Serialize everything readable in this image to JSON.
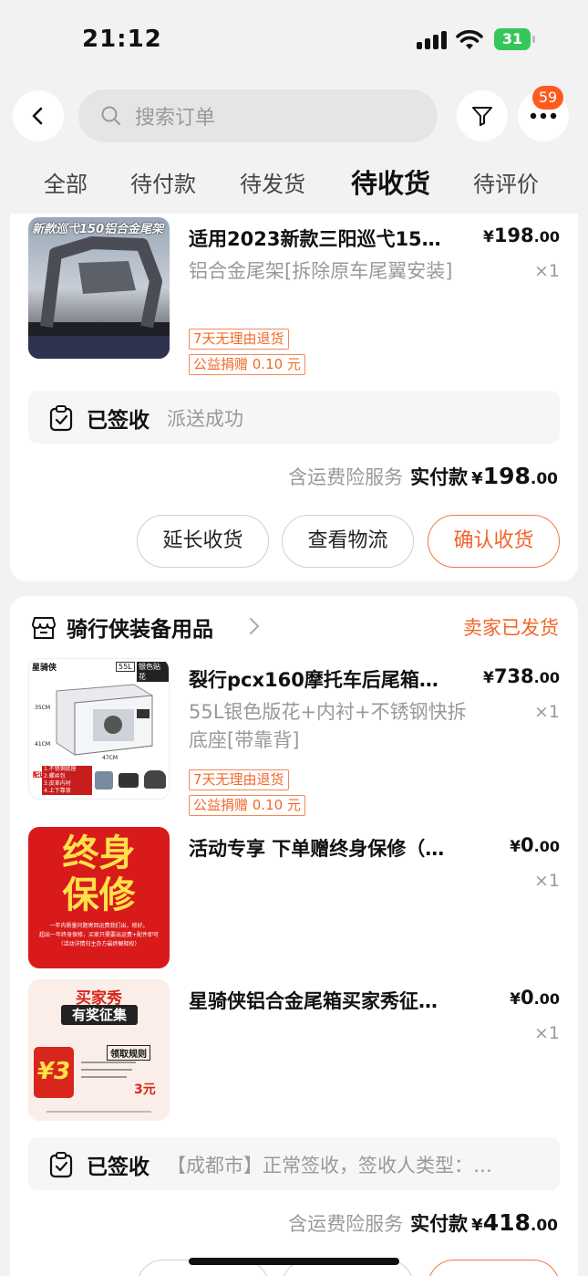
{
  "status_bar": {
    "time": "21:12",
    "battery": "31"
  },
  "header": {
    "search_placeholder": "搜索订单",
    "badge_count": "59",
    "tabs": [
      {
        "label": "全部"
      },
      {
        "label": "待付款"
      },
      {
        "label": "待发货"
      },
      {
        "label": "待收货",
        "active": true
      },
      {
        "label": "待评价"
      }
    ]
  },
  "orders": [
    {
      "items": [
        {
          "thumb_text": "新款巡弋150铝合金尾架",
          "title": "适用2023新款三阳巡弋15…",
          "price": {
            "currency": "¥",
            "int": "198",
            "dec": ".00"
          },
          "spec": "铝合金尾架[拆除原车尾翼安装]",
          "qty": "×1",
          "tags": [
            "7天无理由退货",
            "公益捐赠 0.10 元"
          ]
        }
      ],
      "status": {
        "title": "已签收",
        "detail": "派送成功"
      },
      "total": {
        "service": "含运费险服务",
        "label": "实付款",
        "currency": "¥",
        "int": "198",
        "dec": ".00"
      },
      "buttons": [
        "延长收货",
        "查看物流",
        "确认收货"
      ]
    },
    {
      "shop_name": "骑行侠装备用品",
      "shop_state": "卖家已发货",
      "items": [
        {
          "thumb_text": [
            "星骑侠",
            "55L",
            "银色贴花",
            "35CM",
            "41CM",
            "47CM",
            "1.不锈钢底座",
            "2.螺丝包",
            "3.皮革内衬",
            "4.上下靠背",
            "配送"
          ],
          "title": "裂行pcx160摩托车后尾箱…",
          "price": {
            "currency": "¥",
            "int": "738",
            "dec": ".00"
          },
          "spec": "55L银色版花+内衬+不锈钢快拆底座[带靠背]",
          "qty": "×1",
          "tags": [
            "7天无理由退货",
            "公益捐赠 0.10 元"
          ]
        },
        {
          "thumb_text": [
            "终身",
            "保修",
            "一年内质量问题寄回运费我们出，修好。",
            "超出一年终身保修，买家只需要出运费+配件即可",
            "（活动详情归主办方最终解释权）"
          ],
          "title": "活动专享 下单赠终身保修（…",
          "price": {
            "currency": "¥",
            "int": "0",
            "dec": ".00"
          },
          "qty": "×1"
        },
        {
          "thumb_text": [
            "买家秀",
            "有奖征集",
            "领取规则",
            "¥3",
            "3元"
          ],
          "title": "星骑侠铝合金尾箱买家秀征…",
          "price": {
            "currency": "¥",
            "int": "0",
            "dec": ".00"
          },
          "qty": "×1"
        }
      ],
      "status": {
        "title": "已签收",
        "detail": "【成都市】正常签收，签收人类型：…"
      },
      "total": {
        "service": "含运费险服务",
        "label": "实付款",
        "currency": "¥",
        "int": "418",
        "dec": ".00"
      }
    }
  ],
  "colors": {
    "accent": "#f2652a",
    "badge": "#ff5a1f",
    "battery": "#35c759"
  }
}
